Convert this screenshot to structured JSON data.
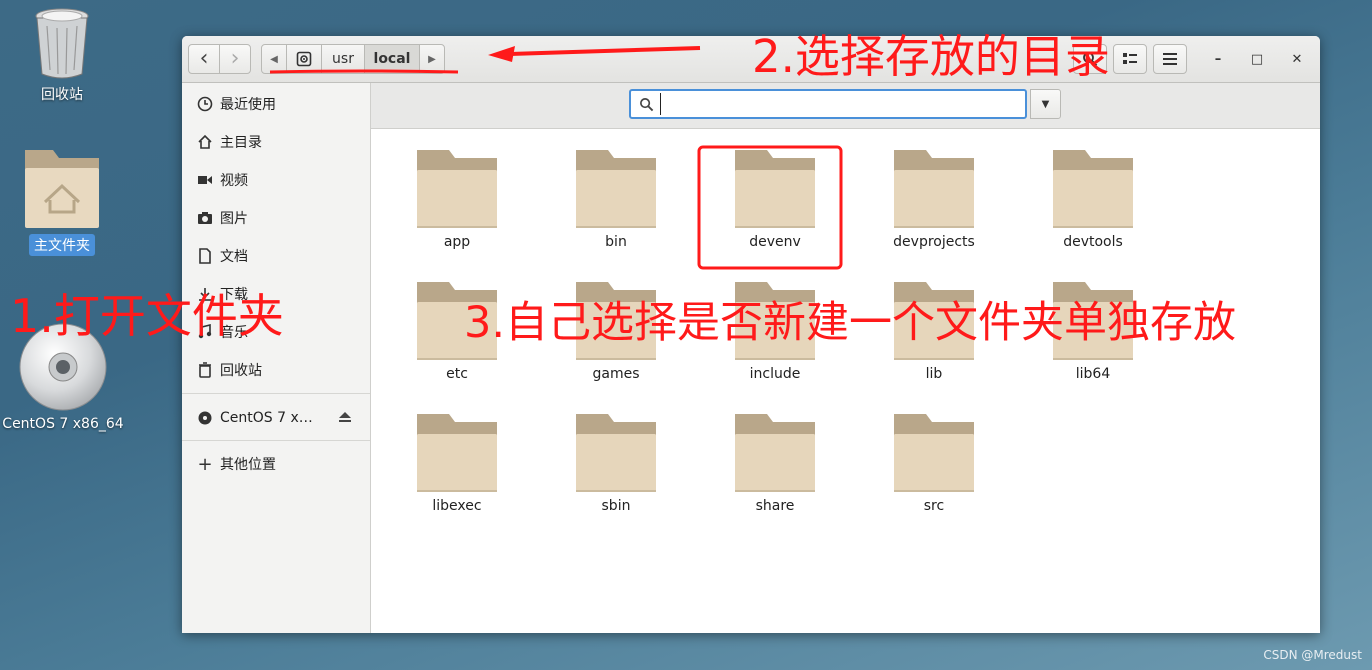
{
  "desktop": {
    "icons": [
      {
        "label": "回收站",
        "icon": "trash-icon"
      },
      {
        "label": "主文件夹",
        "icon": "home-folder-icon"
      },
      {
        "label": "CentOS 7 x86_64",
        "icon": "disc-icon"
      }
    ]
  },
  "window": {
    "nav": {
      "back": "‹",
      "forward": "›"
    },
    "breadcrumbs": [
      "usr",
      "local"
    ],
    "active_crumb": "local",
    "controls": {
      "minimize": "–",
      "maximize": "□",
      "close": "✕"
    }
  },
  "sidebar": {
    "items": [
      {
        "label": "最近使用",
        "icon": "clock-icon"
      },
      {
        "label": "主目录",
        "icon": "home-icon"
      },
      {
        "label": "视频",
        "icon": "video-icon"
      },
      {
        "label": "图片",
        "icon": "camera-icon"
      },
      {
        "label": "文档",
        "icon": "document-icon"
      },
      {
        "label": "下载",
        "icon": "download-icon"
      },
      {
        "label": "音乐",
        "icon": "music-icon"
      },
      {
        "label": "回收站",
        "icon": "trash-icon"
      }
    ],
    "device": {
      "label": "CentOS 7 x…",
      "icon": "disc-icon",
      "eject": "eject-icon"
    },
    "other": {
      "label": "其他位置",
      "icon": "plus-icon"
    }
  },
  "search": {
    "value": "",
    "placeholder": ""
  },
  "folders": [
    "app",
    "bin",
    "devenv",
    "devprojects",
    "devtools",
    "etc",
    "games",
    "include",
    "lib",
    "lib64",
    "libexec",
    "sbin",
    "share",
    "src"
  ],
  "highlighted_folder": "devenv",
  "annotations": {
    "step1": "1.打开文件夹",
    "step2": "2.选择存放的目录",
    "step3": "3.自己选择是否新建一个文件夹单独存放"
  },
  "watermark": "CSDN @Mredust",
  "colors": {
    "annotation": "#ff1a1a",
    "accent": "#4a90d9",
    "folder": "#e6d6bb"
  }
}
